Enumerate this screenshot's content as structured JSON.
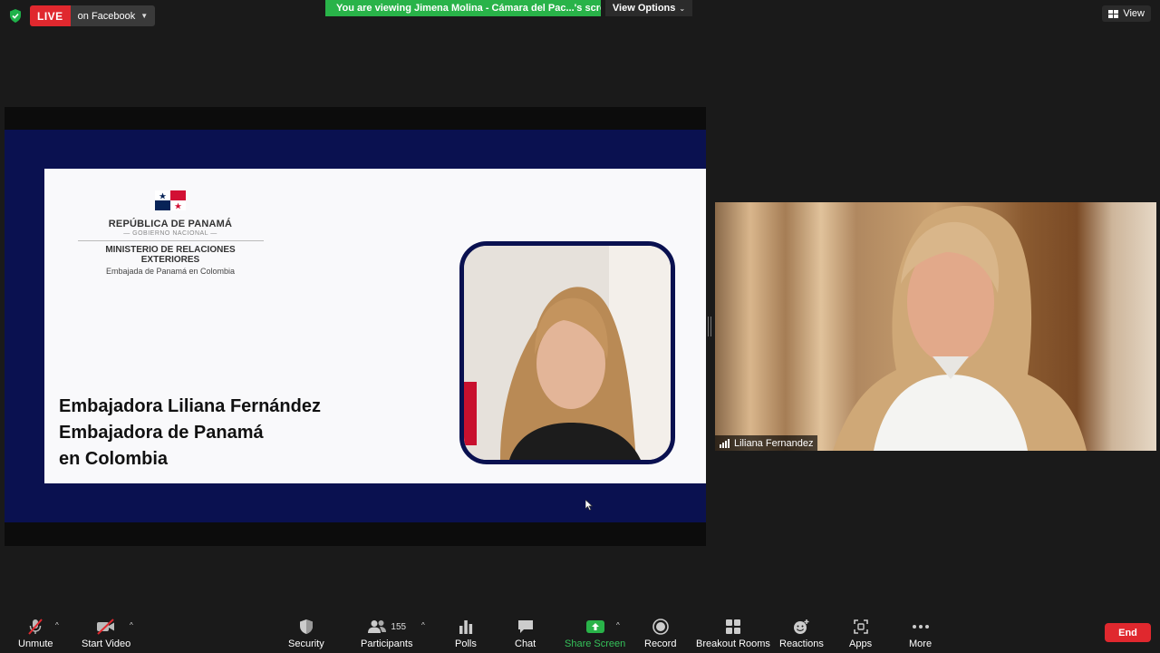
{
  "top": {
    "live_label": "LIVE",
    "live_target": "on Facebook",
    "viewing_banner": "You are viewing Jimena Molina - Cámara del Pac...'s screen",
    "view_options": "View Options",
    "view_button": "View"
  },
  "slide": {
    "gov_title": "REPÚBLICA DE PANAMÁ",
    "gov_subtitle": "— GOBIERNO NACIONAL —",
    "ministry": "MINISTERIO DE RELACIONES EXTERIORES",
    "embassy": "Embajada de Panamá en Colombia",
    "line1": "Embajadora Liliana Fernández",
    "line2": "Embajadora de Panamá",
    "line3": "en Colombia"
  },
  "participant": {
    "name": "Liliana Fernandez"
  },
  "toolbar": {
    "unmute": "Unmute",
    "start_video": "Start Video",
    "security": "Security",
    "participants": "Participants",
    "participants_count": "155",
    "polls": "Polls",
    "chat": "Chat",
    "share_screen": "Share Screen",
    "record": "Record",
    "breakout_rooms": "Breakout Rooms",
    "reactions": "Reactions",
    "apps": "Apps",
    "more": "More",
    "end": "End"
  },
  "colors": {
    "live_red": "#e0282e",
    "banner_green": "#29b349",
    "slide_navy": "#0a1150",
    "share_green": "#35c25a"
  },
  "icons": [
    "shield-check-icon",
    "caret-down-icon",
    "speaker-icon",
    "grid-view-icon",
    "mic-muted-icon",
    "video-off-icon",
    "security-shield-icon",
    "participants-icon",
    "polls-icon",
    "chat-icon",
    "share-screen-icon",
    "record-icon",
    "breakout-rooms-icon",
    "reactions-icon",
    "apps-icon",
    "more-icon",
    "signal-bars-icon"
  ]
}
